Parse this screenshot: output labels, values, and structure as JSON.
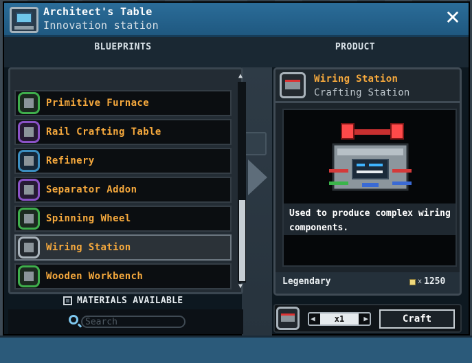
{
  "window": {
    "title": "Architect's Table",
    "subtitle": "Innovation station",
    "close_label": "✕"
  },
  "headers": {
    "blueprints": "BLUEPRINTS",
    "product": "PRODUCT"
  },
  "blueprints": {
    "items": [
      {
        "label": "Primitive Furnace",
        "icon": "furnace-icon"
      },
      {
        "label": "Rail Crafting Table",
        "icon": "rail-table-icon"
      },
      {
        "label": "Refinery",
        "icon": "refinery-icon"
      },
      {
        "label": "Separator Addon",
        "icon": "separator-icon"
      },
      {
        "label": "Spinning Wheel",
        "icon": "spinning-wheel-icon"
      },
      {
        "label": "Wiring Station",
        "icon": "wiring-station-icon",
        "selected": true
      },
      {
        "label": "Wooden Workbench",
        "icon": "workbench-icon"
      }
    ],
    "scroll_position": 0.85
  },
  "materials_available_label": "MATERIALS AVAILABLE",
  "search": {
    "placeholder": "Search",
    "value": ""
  },
  "product": {
    "name": "Wiring Station",
    "type": "Crafting Station",
    "description": "Used to produce complex wiring components.",
    "rarity": "Legendary",
    "price_prefix": "x",
    "price": "1250"
  },
  "craft": {
    "quantity": "x1",
    "decrement": "◀",
    "increment": "▶",
    "button_label": "Craft"
  },
  "colors": {
    "title_bar": "#2b6d99",
    "item_label": "#f6a93d"
  }
}
